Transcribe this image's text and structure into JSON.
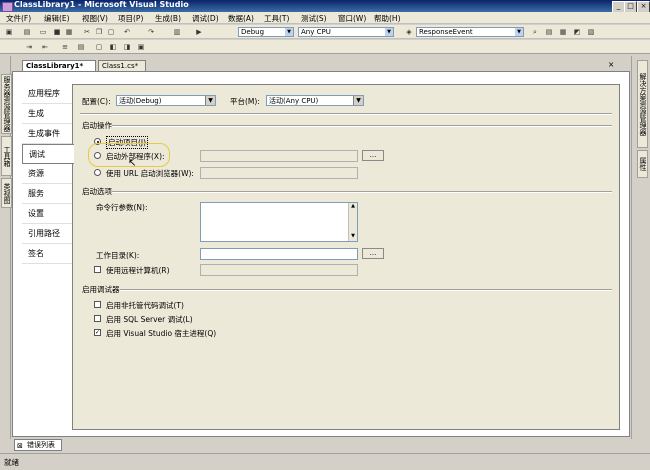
{
  "window": {
    "title": "ClassLibrary1 - Microsoft Visual Studio"
  },
  "menu": [
    "文件(F)",
    "编辑(E)",
    "视图(V)",
    "项目(P)",
    "生成(B)",
    "调试(D)",
    "数据(A)",
    "工具(T)",
    "测试(S)",
    "窗口(W)",
    "帮助(H)"
  ],
  "toolbar": {
    "config_combo": "Debug",
    "platform_combo": "Any CPU",
    "find_combo": "ResponseEvent"
  },
  "left_rail": [
    "服务器资源管理器",
    "工具箱",
    "类视图"
  ],
  "right_rail": [
    "解决方案资源管理器",
    "属性"
  ],
  "doc_tabs": [
    "ClassLibrary1*",
    "Class1.cs*"
  ],
  "page_tabs": [
    "应用程序",
    "生成",
    "生成事件",
    "调试",
    "资源",
    "服务",
    "设置",
    "引用路径",
    "签名"
  ],
  "active_page_tab": "调试",
  "config": {
    "config_label": "配置(C):",
    "config_value": "活动(Debug)",
    "platform_label": "平台(M):",
    "platform_value": "活动(Any CPU)"
  },
  "start_action": {
    "heading": "启动操作",
    "opt_project": "启动项目(J)",
    "opt_external": "启动外部程序(X):",
    "opt_browser": "使用 URL 启动浏览器(W):",
    "browse_button": "..."
  },
  "start_options": {
    "heading": "启动选项",
    "cmd_args_label": "命令行参数(N):",
    "working_dir_label": "工作目录(K):",
    "remote_label": "使用远程计算机(R)",
    "browse_button": "..."
  },
  "debuggers": {
    "heading": "启用调试器",
    "unmanaged": "启用非托管代码调试(T)",
    "sql": "启用 SQL Server 调试(L)",
    "vshost": "启用 Visual Studio 宿主进程(Q)",
    "vshost_checked": true
  },
  "bottom_panel_tab": "错误列表",
  "status": {
    "text": "就绪"
  }
}
